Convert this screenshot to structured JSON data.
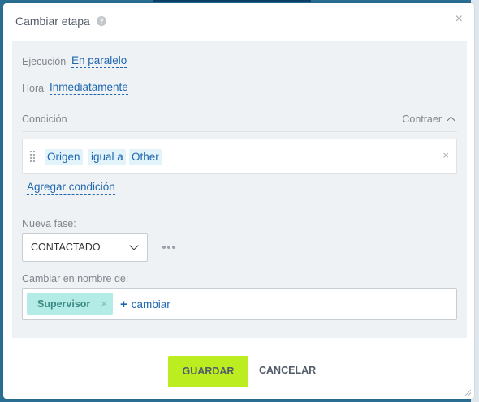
{
  "dialog": {
    "title": "Cambiar etapa",
    "help_icon": "question-circle-icon",
    "close_icon": "close-icon"
  },
  "execution": {
    "label": "Ejecución",
    "value": "En paralelo"
  },
  "time": {
    "label": "Hora",
    "value": "Inmediatamente"
  },
  "condition": {
    "title": "Condición",
    "collapse_label": "Contraer",
    "field": "Origen",
    "operator": "igual a",
    "value": "Other",
    "add_label": "Agregar condición"
  },
  "new_phase": {
    "label": "Nueva fase:",
    "selected": "CONTACTADO"
  },
  "on_behalf": {
    "label": "Cambiar en nombre de:",
    "user": "Supervisor",
    "change_label": "cambiar",
    "change_prefix": "+"
  },
  "buttons": {
    "save": "GUARDAR",
    "cancel": "CANCELAR"
  },
  "colors": {
    "accent": "#2067b0",
    "save_button": "#bbed21",
    "user_chip": "#b3ebe6",
    "panel": "#eef2f4"
  }
}
